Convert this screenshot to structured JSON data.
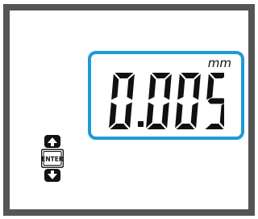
{
  "display": {
    "reading": "0.005",
    "unit": "mm",
    "accent_color": "#1e9ad6"
  },
  "controls": {
    "up_icon": "arrow-up-icon",
    "enter_label": "ENTER",
    "down_icon": "arrow-down-icon"
  }
}
